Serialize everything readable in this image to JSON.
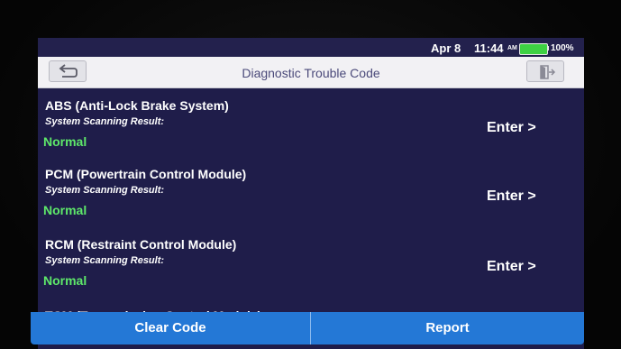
{
  "status_bar": {
    "date": "Apr 8",
    "time": "11:44",
    "ampm": "AM",
    "battery": "100%",
    "battery_icon": "battery-full-icon"
  },
  "header": {
    "title": "Diagnostic Trouble Code",
    "back_icon": "back-arrow-icon",
    "exit_icon": "exit-icon"
  },
  "modules": [
    {
      "name": "ABS (Anti-Lock Brake System)",
      "scan_label": "System Scanning Result:",
      "status": "Normal",
      "action": "Enter >"
    },
    {
      "name": "PCM (Powertrain Control Module)",
      "scan_label": "System Scanning Result:",
      "status": "Normal",
      "action": "Enter >"
    },
    {
      "name": "RCM (Restraint Control Module)",
      "scan_label": "System Scanning Result:",
      "status": "Normal",
      "action": "Enter >"
    },
    {
      "name": "TCM (Transmission Control Module)"
    }
  ],
  "footer": {
    "clear_label": "Clear Code",
    "report_label": "Report"
  },
  "colors": {
    "background": "#1f1d4a",
    "status_ok": "#5ee86a",
    "button": "#2478d6",
    "title_text": "#4b4a7a"
  }
}
